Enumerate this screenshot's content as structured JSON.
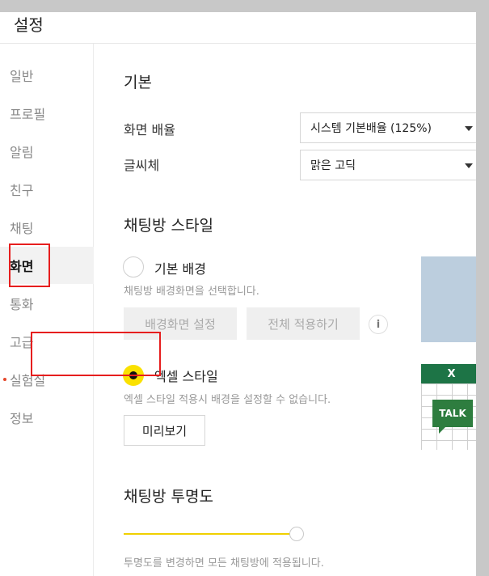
{
  "window": {
    "title": "설정"
  },
  "sidebar": {
    "items": [
      {
        "label": "일반"
      },
      {
        "label": "프로필"
      },
      {
        "label": "알림"
      },
      {
        "label": "친구"
      },
      {
        "label": "채팅"
      },
      {
        "label": "화면"
      },
      {
        "label": "통화"
      },
      {
        "label": "고급"
      },
      {
        "label": "실험실"
      },
      {
        "label": "정보"
      }
    ],
    "active_item": "화면"
  },
  "basic": {
    "heading": "기본",
    "zoom_label": "화면 배율",
    "zoom_value": "시스템 기본배율 (125%)",
    "font_label": "글씨체",
    "font_value": "맑은 고딕"
  },
  "chat_style": {
    "heading": "채팅방 스타일",
    "option_default": {
      "label": "기본 배경",
      "desc": "채팅방 배경화면을 선택합니다.",
      "selected": false
    },
    "set_bg_button": "배경화면 설정",
    "apply_all_button": "전체 적용하기",
    "info_glyph": "i",
    "option_excel": {
      "label": "엑셀 스타일",
      "desc": "엑셀 스타일 적용시 배경을 설정할 수 없습니다.",
      "selected": true
    },
    "preview_button": "미리보기",
    "excel_preview": {
      "header": "X",
      "bubble": "TALK"
    }
  },
  "transparency": {
    "heading": "채팅방 투명도",
    "slider_value": 1.0,
    "desc": "투명도를 변경하면 모든 채팅방에 적용됩니다."
  },
  "colors": {
    "accent_yellow": "#fae100",
    "highlight_red": "#e61e1e",
    "excel_green": "#1d7446",
    "preview_blue": "#bccede"
  }
}
